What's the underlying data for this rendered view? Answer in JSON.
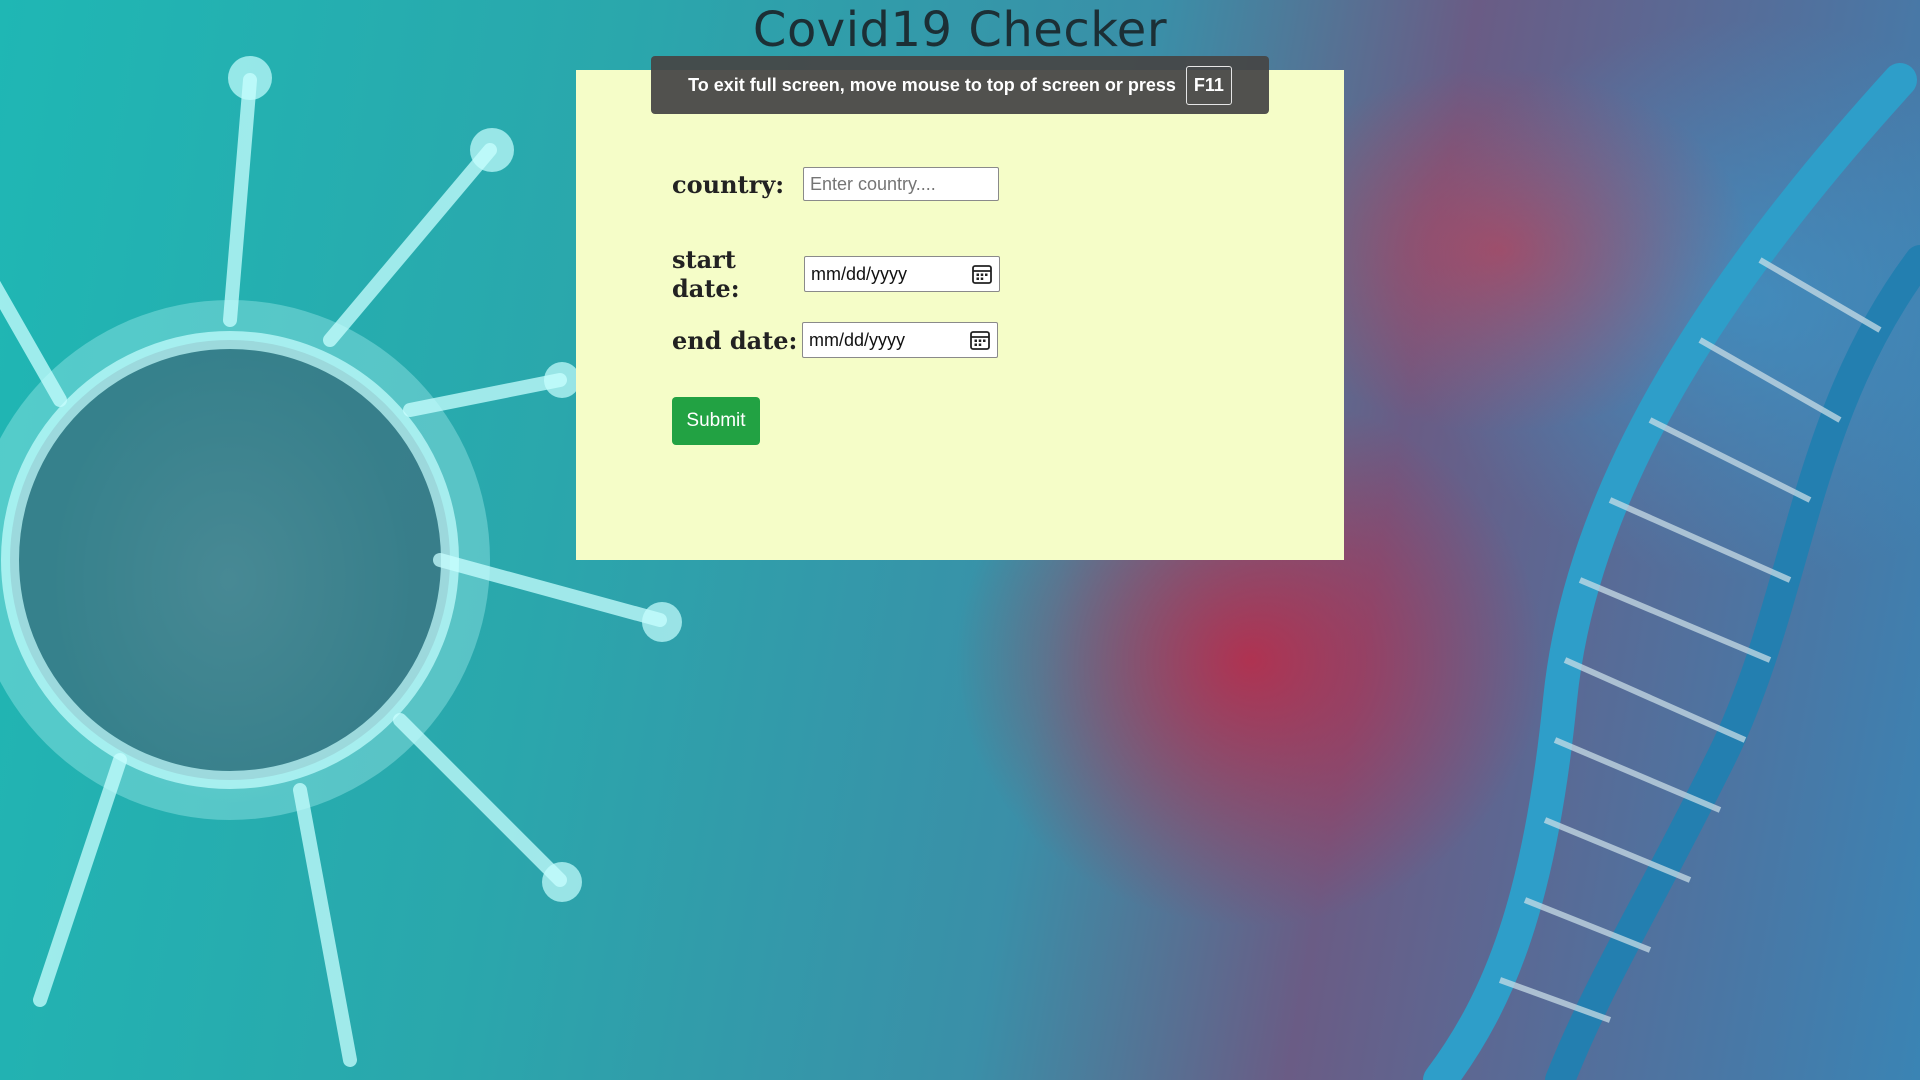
{
  "page": {
    "title": "Covid19 Checker"
  },
  "fullscreen_notice": {
    "message": "To exit full screen, move mouse to top of screen or press",
    "key": "F11"
  },
  "form": {
    "country": {
      "label": "country:",
      "value": "",
      "placeholder": "Enter country...."
    },
    "start_date": {
      "label": "start date:",
      "value": "mm/dd/yyyy",
      "icon": "calendar-icon"
    },
    "end_date": {
      "label": "end date:",
      "value": "mm/dd/yyyy",
      "icon": "calendar-icon"
    },
    "submit_label": "Submit"
  },
  "colors": {
    "panel_background": "#f5fdc8",
    "submit_button": "#22a243",
    "title_text": "#1c2f35"
  }
}
